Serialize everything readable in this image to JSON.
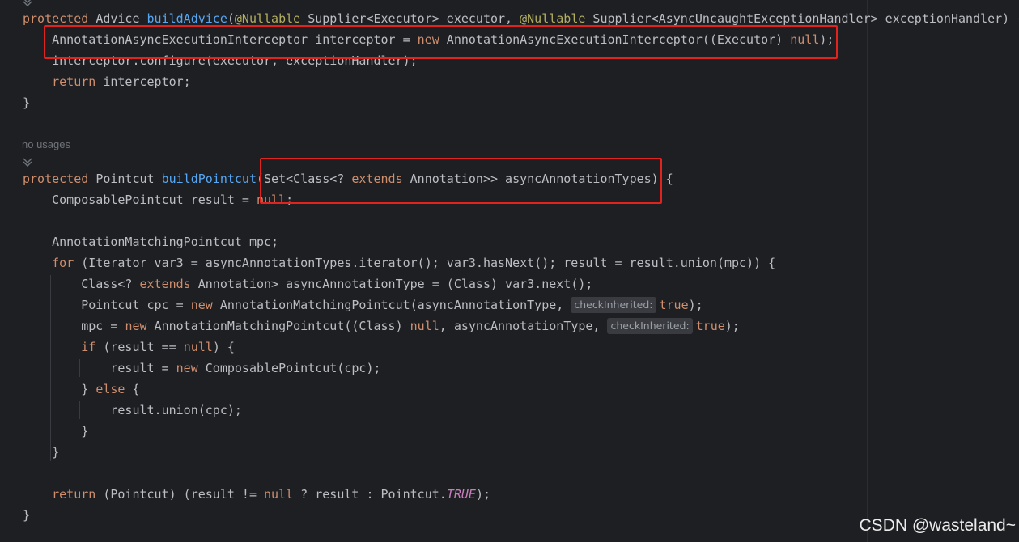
{
  "code": {
    "lines": [
      [
        [
          "kw",
          "protected "
        ],
        [
          "p",
          "Advice "
        ],
        [
          "fn",
          "buildAdvice"
        ],
        [
          "p",
          "("
        ],
        [
          "an",
          "@Nullable"
        ],
        [
          "p",
          " Supplier<Executor> executor, "
        ],
        [
          "an",
          "@Nullable"
        ],
        [
          "p",
          " Supplier<AsyncUncaughtExceptionHandler> exceptionHandler) {"
        ]
      ],
      [
        [
          "p",
          "    AnnotationAsyncExecutionInterceptor interceptor = "
        ],
        [
          "kw",
          "new"
        ],
        [
          "p",
          " AnnotationAsyncExecutionInterceptor((Executor) "
        ],
        [
          "kw",
          "null"
        ],
        [
          "p",
          ");"
        ]
      ],
      [
        [
          "p",
          "    interceptor.configure(executor, exceptionHandler);"
        ]
      ],
      [
        [
          "p",
          "    "
        ],
        [
          "kw",
          "return"
        ],
        [
          "p",
          " interceptor;"
        ]
      ],
      [
        [
          "p",
          "}"
        ]
      ],
      [
        [
          "p",
          ""
        ]
      ],
      [
        [
          "kw",
          "protected "
        ],
        [
          "p",
          "Pointcut "
        ],
        [
          "fn",
          "buildPointcut"
        ],
        [
          "p",
          "(Set<Class<? "
        ],
        [
          "kw",
          "extends"
        ],
        [
          "p",
          " Annotation>> asyncAnnotationTypes) {"
        ]
      ],
      [
        [
          "p",
          "    ComposablePointcut result = "
        ],
        [
          "kw",
          "null"
        ],
        [
          "p",
          ";"
        ]
      ],
      [
        [
          "p",
          ""
        ]
      ],
      [
        [
          "p",
          "    AnnotationMatchingPointcut mpc;"
        ]
      ],
      [
        [
          "p",
          "    "
        ],
        [
          "kw",
          "for"
        ],
        [
          "p",
          " (Iterator var3 = asyncAnnotationTypes.iterator(); var3.hasNext(); result = result.union(mpc)) {"
        ]
      ],
      [
        [
          "p",
          "        Class<? "
        ],
        [
          "kw",
          "extends"
        ],
        [
          "p",
          " Annotation> asyncAnnotationType = (Class) var3.next();"
        ]
      ],
      [
        [
          "p",
          "        Pointcut cpc = "
        ],
        [
          "kw",
          "new"
        ],
        [
          "p",
          " AnnotationMatchingPointcut(asyncAnnotationType, "
        ],
        [
          "hint",
          "checkInherited:"
        ],
        [
          "kw",
          "true"
        ],
        [
          "p",
          ");"
        ]
      ],
      [
        [
          "p",
          "        mpc = "
        ],
        [
          "kw",
          "new"
        ],
        [
          "p",
          " AnnotationMatchingPointcut((Class) "
        ],
        [
          "kw",
          "null"
        ],
        [
          "p",
          ", asyncAnnotationType, "
        ],
        [
          "hint",
          "checkInherited:"
        ],
        [
          "kw",
          "true"
        ],
        [
          "p",
          ");"
        ]
      ],
      [
        [
          "p",
          "        "
        ],
        [
          "kw",
          "if"
        ],
        [
          "p",
          " (result == "
        ],
        [
          "kw",
          "null"
        ],
        [
          "p",
          ") {"
        ]
      ],
      [
        [
          "p",
          "            result = "
        ],
        [
          "kw",
          "new"
        ],
        [
          "p",
          " ComposablePointcut(cpc);"
        ]
      ],
      [
        [
          "p",
          "        } "
        ],
        [
          "kw",
          "else"
        ],
        [
          "p",
          " {"
        ]
      ],
      [
        [
          "p",
          "            result.union(cpc);"
        ]
      ],
      [
        [
          "p",
          "        }"
        ]
      ],
      [
        [
          "p",
          "    }"
        ]
      ],
      [
        [
          "p",
          ""
        ]
      ],
      [
        [
          "p",
          "    "
        ],
        [
          "kw",
          "return"
        ],
        [
          "p",
          " (Pointcut) (result != "
        ],
        [
          "kw",
          "null"
        ],
        [
          "p",
          " ? result : Pointcut."
        ],
        [
          "const",
          "TRUE"
        ],
        [
          "p",
          ");"
        ]
      ],
      [
        [
          "p",
          "}"
        ]
      ]
    ]
  },
  "usages_label": "no usages",
  "watermark": "CSDN @wasteland~",
  "colors": {
    "background": "#1e1f22",
    "keyword": "#cf8e6d",
    "function": "#56a8f5",
    "annotation": "#b3ae60",
    "constant": "#c77dbb",
    "text": "#bcbec4",
    "highlight_box": "#e0231e"
  }
}
